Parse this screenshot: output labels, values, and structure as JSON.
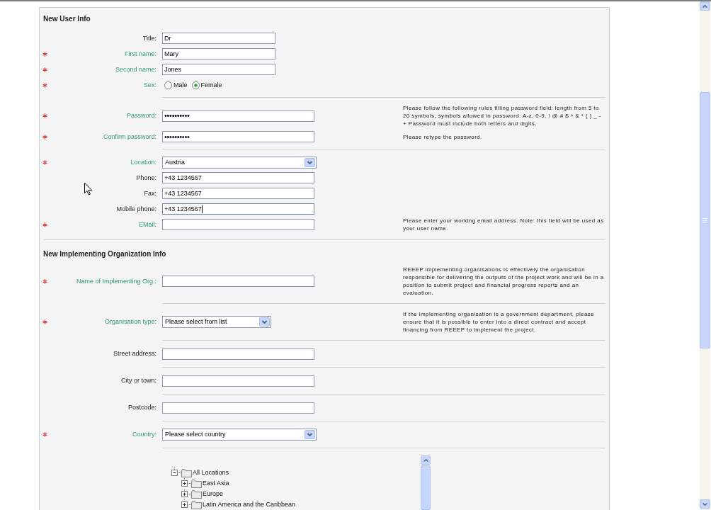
{
  "sections": [
    {
      "title": "New User Info",
      "groups": [
        {
          "rows": [
            {
              "kind": "text",
              "label": "Title:",
              "required": false,
              "value": "Dr",
              "focused": false
            },
            {
              "kind": "text",
              "label": "First name:",
              "required": true,
              "value": "Mary",
              "focused": false
            },
            {
              "kind": "text",
              "label": "Second name:",
              "required": true,
              "value": "Jones",
              "focused": false
            },
            {
              "kind": "radio",
              "label": "Sex:",
              "required": true,
              "options": [
                {
                  "label": "Male",
                  "selected": false
                },
                {
                  "label": "Female",
                  "selected": true
                }
              ]
            }
          ]
        },
        {
          "rows": [
            {
              "kind": "password",
              "label": "Password:",
              "required": true,
              "value": "••••••••••",
              "help": "Please follow the following rules filling password field: length from 5 to 20 symbols, symbols allowed in password: A-z, 0-9, ! @ # $ ^ & * ( ) _ - + Password must include both letters and digits."
            },
            {
              "kind": "password",
              "label": "Confirm password:",
              "required": true,
              "value": "••••••••••",
              "help": "Please retype the password."
            }
          ]
        },
        {
          "rows": [
            {
              "kind": "select",
              "label": "Location:",
              "required": true,
              "value": "Austria"
            },
            {
              "kind": "text",
              "label": "Phone:",
              "required": false,
              "value": "+43 1234567",
              "focused": false
            },
            {
              "kind": "text",
              "label": "Fax:",
              "required": false,
              "value": "+43 1234567",
              "focused": false
            },
            {
              "kind": "text",
              "label": "Mobile phone:",
              "required": false,
              "value": "+43 1234567",
              "focused": true
            },
            {
              "kind": "text",
              "label": "EMail:",
              "required": true,
              "focused": false,
              "help": "Please enter your working email address. Note: this field will be used as your user name."
            }
          ]
        }
      ]
    },
    {
      "title": "New Implementing Organization Info",
      "groups": [
        {
          "rows": [
            {
              "kind": "text",
              "label": "Name of Implementing Org.:",
              "required": true,
              "focused": false,
              "help": "REEEP implementing organisations is effectively the organisation responsible for delivering the outputs of the project work and will be in a position to submit project and financial progress reports and an evaluation."
            }
          ]
        },
        {
          "rows": [
            {
              "kind": "select",
              "label": "Organisation type:",
              "required": true,
              "value": "Please select from list",
              "help": "If the implementing organisation is a government department, please ensure that it is possible to enter into a direct contract and accept financing from REEEP to implement the project."
            }
          ]
        },
        {
          "rows": [
            {
              "kind": "text",
              "label": "Street address:",
              "required": false,
              "focused": false
            }
          ]
        },
        {
          "rows": [
            {
              "kind": "text",
              "label": "City or town:",
              "required": false,
              "focused": false
            }
          ]
        },
        {
          "rows": [
            {
              "kind": "text",
              "label": "Postcode:",
              "required": false,
              "focused": false
            }
          ]
        },
        {
          "rows": [
            {
              "kind": "select",
              "label": "Country:",
              "required": true,
              "value": "Please select country"
            }
          ]
        }
      ],
      "location_tree": [
        {
          "label": "All Locations",
          "expanded": true,
          "children": [
            {
              "label": "East Asia",
              "expanded": false
            },
            {
              "label": "Europe",
              "expanded": false
            },
            {
              "label": "Latin America and the Caribbean",
              "expanded": false
            }
          ]
        }
      ]
    }
  ]
}
